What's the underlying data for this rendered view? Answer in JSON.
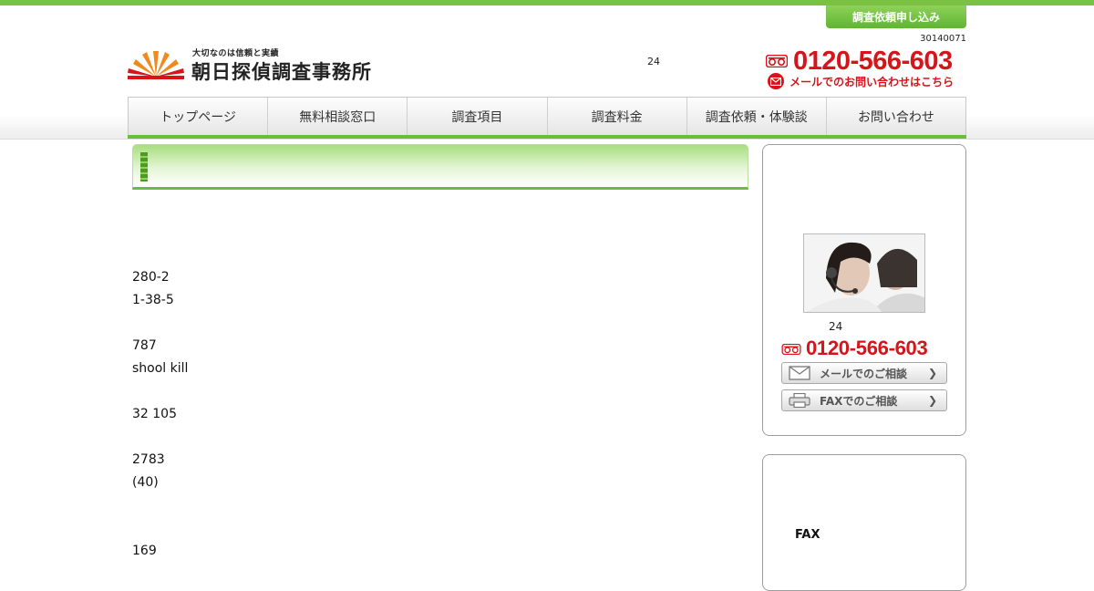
{
  "header": {
    "request_button": "調査依頼申し込み",
    "code": "30140071",
    "hours": "24",
    "phone": "0120-566-603",
    "mail_link": "メールでのお問い合わせはこちら"
  },
  "logo": {
    "tagline": "大切なのは信頼と実績",
    "name": "朝日探偵調査事務所"
  },
  "nav": {
    "items": [
      "トップページ",
      "無料相談窓口",
      "調査項目",
      "調査料金",
      "調査依頼・体験談",
      "お問い合わせ"
    ]
  },
  "main": {
    "title": "",
    "lines": [
      "280-2",
      "1-38-5",
      "",
      "787",
      "shool kill",
      "",
      "32 105",
      "",
      "2783",
      "(40)",
      "",
      "",
      "169"
    ]
  },
  "sidebar": {
    "consult_box": {
      "title": "",
      "hours": "24",
      "phone": "0120-566-603",
      "mail_button": "メールでのご相談",
      "fax_button": "FAXでのご相談"
    },
    "second_box": {
      "title": "",
      "fax_label": "FAX"
    }
  },
  "colors": {
    "brand_green": "#6cbd3a",
    "accent_red": "#d7141a",
    "navy": "#1f2a7a"
  }
}
